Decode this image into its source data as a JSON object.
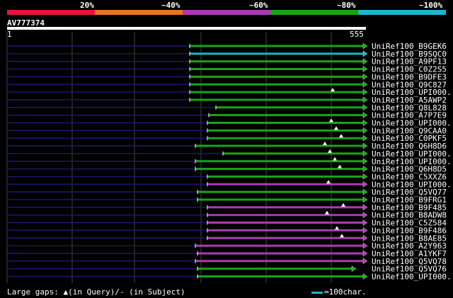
{
  "legend": {
    "labels": [
      "20%",
      "~40%",
      "~60%",
      "~80%",
      "~100%"
    ],
    "colors": [
      "#e4163a",
      "#e67622",
      "#a83cb0",
      "#18a418",
      "#18b8c8"
    ]
  },
  "query": {
    "name": "AV777374",
    "start": "1",
    "end": "555"
  },
  "hits": [
    {
      "label": "UniRef100_B9GEK6",
      "s": 268,
      "e": 513,
      "c": "#18a418",
      "tri": false
    },
    {
      "label": "UniRef100_B9SQC0",
      "s": 268,
      "e": 513,
      "c": "#18b8c8",
      "tri": false
    },
    {
      "label": "UniRef100_A9PF13",
      "s": 268,
      "e": 513,
      "c": "#18a418",
      "tri": false
    },
    {
      "label": "UniRef100_C0Z2S5",
      "s": 268,
      "e": 513,
      "c": "#18a418",
      "tri": false
    },
    {
      "label": "UniRef100_B9DFE3",
      "s": 268,
      "e": 513,
      "c": "#18a418",
      "tri": false
    },
    {
      "label": "UniRef100_Q9C827",
      "s": 268,
      "e": 513,
      "c": "#18a418",
      "tri": false
    },
    {
      "label": "UniRef100_UPI000..",
      "s": 268,
      "e": 513,
      "c": "#18a418",
      "tri": true
    },
    {
      "label": "UniRef100_A5AWP2",
      "s": 268,
      "e": 513,
      "c": "#18a418",
      "tri": false
    },
    {
      "label": "UniRef100_Q8L828",
      "s": 305,
      "e": 513,
      "c": "#18a418",
      "tri": false
    },
    {
      "label": "UniRef100_A7P7E9",
      "s": 295,
      "e": 513,
      "c": "#18a418",
      "tri": false
    },
    {
      "label": "UniRef100_UPI000..",
      "s": 293,
      "e": 513,
      "c": "#18a418",
      "tri": true
    },
    {
      "label": "UniRef100_Q9CAA0",
      "s": 293,
      "e": 513,
      "c": "#18a418",
      "tri": true
    },
    {
      "label": "UniRef100_C0PKF5",
      "s": 293,
      "e": 513,
      "c": "#18a418",
      "tri": true
    },
    {
      "label": "UniRef100_Q6H8D6",
      "s": 276,
      "e": 513,
      "c": "#18a418",
      "tri": true
    },
    {
      "label": "UniRef100_UPI000..",
      "s": 315,
      "e": 513,
      "c": "#18a418",
      "tri": true
    },
    {
      "label": "UniRef100_UPI000..",
      "s": 276,
      "e": 513,
      "c": "#18a418",
      "tri": true
    },
    {
      "label": "UniRef100_Q6H8D5",
      "s": 276,
      "e": 513,
      "c": "#18a418",
      "tri": true
    },
    {
      "label": "UniRef100_C5XXZ6",
      "s": 293,
      "e": 513,
      "c": "#18a418",
      "tri": false
    },
    {
      "label": "UniRef100_UPI000..",
      "s": 293,
      "e": 513,
      "c": "#a83cb0",
      "tri": true
    },
    {
      "label": "UniRef100_Q5VQ77",
      "s": 279,
      "e": 513,
      "c": "#18a418",
      "tri": false
    },
    {
      "label": "UniRef100_B9FRG1",
      "s": 279,
      "e": 513,
      "c": "#18a418",
      "tri": false
    },
    {
      "label": "UniRef100_B9F485",
      "s": 293,
      "e": 513,
      "c": "#a83cb0",
      "tri": true
    },
    {
      "label": "UniRef100_B8ADW8",
      "s": 293,
      "e": 513,
      "c": "#a83cb0",
      "tri": true
    },
    {
      "label": "UniRef100_C5Z584",
      "s": 293,
      "e": 513,
      "c": "#a83cb0",
      "tri": false
    },
    {
      "label": "UniRef100_B9F486",
      "s": 293,
      "e": 513,
      "c": "#a83cb0",
      "tri": true
    },
    {
      "label": "UniRef100_B8AE85",
      "s": 293,
      "e": 513,
      "c": "#a83cb0",
      "tri": true
    },
    {
      "label": "UniRef100_A2Y963",
      "s": 276,
      "e": 513,
      "c": "#a83cb0",
      "tri": false
    },
    {
      "label": "UniRef100_A1YKF7",
      "s": 279,
      "e": 513,
      "c": "#a83cb0",
      "tri": false
    },
    {
      "label": "UniRef100_Q5VQ78",
      "s": 276,
      "e": 513,
      "c": "#a83cb0",
      "tri": false
    },
    {
      "label": "UniRef100_Q5VQ76",
      "s": 279,
      "e": 497,
      "c": "#18a418",
      "tri": false
    },
    {
      "label": "UniRef100_UPI000..",
      "s": 279,
      "e": 513,
      "c": "#18a418",
      "tri": false
    }
  ],
  "footer": {
    "text": "Large gaps: ▲(in Query)/- (in Subject)",
    "scale_text": "=100char."
  }
}
